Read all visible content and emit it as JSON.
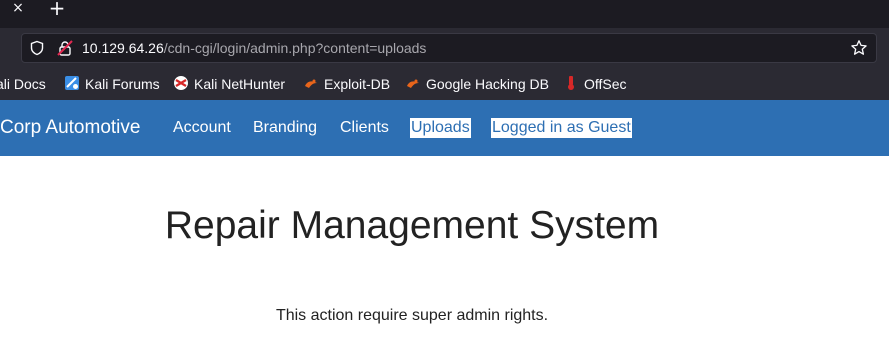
{
  "browser": {
    "tab_close_glyph": "×",
    "new_tab_glyph": "+",
    "url_host": "10.129.64.26",
    "url_path": "/cdn-cgi/login/admin.php?content=uploads",
    "bookmarks": [
      {
        "label": "ali Docs",
        "icon": "kali-docs-icon"
      },
      {
        "label": "Kali Forums",
        "icon": "kali-forums-icon"
      },
      {
        "label": "Kali NetHunter",
        "icon": "kali-nethunter-icon"
      },
      {
        "label": "Exploit-DB",
        "icon": "exploit-db-icon"
      },
      {
        "label": "Google Hacking DB",
        "icon": "exploit-db-icon"
      },
      {
        "label": "OffSec",
        "icon": "offsec-icon"
      }
    ]
  },
  "site": {
    "brand": "Corp Automotive",
    "nav": [
      "Account",
      "Branding",
      "Clients",
      "Uploads",
      "Logged in as Guest"
    ]
  },
  "main": {
    "title": "Repair Management System",
    "message": "This action require super admin rights."
  },
  "colors": {
    "navbar": "#2d6fb3",
    "chrome_dark": "#1c1b22",
    "chrome": "#2b2a33"
  }
}
